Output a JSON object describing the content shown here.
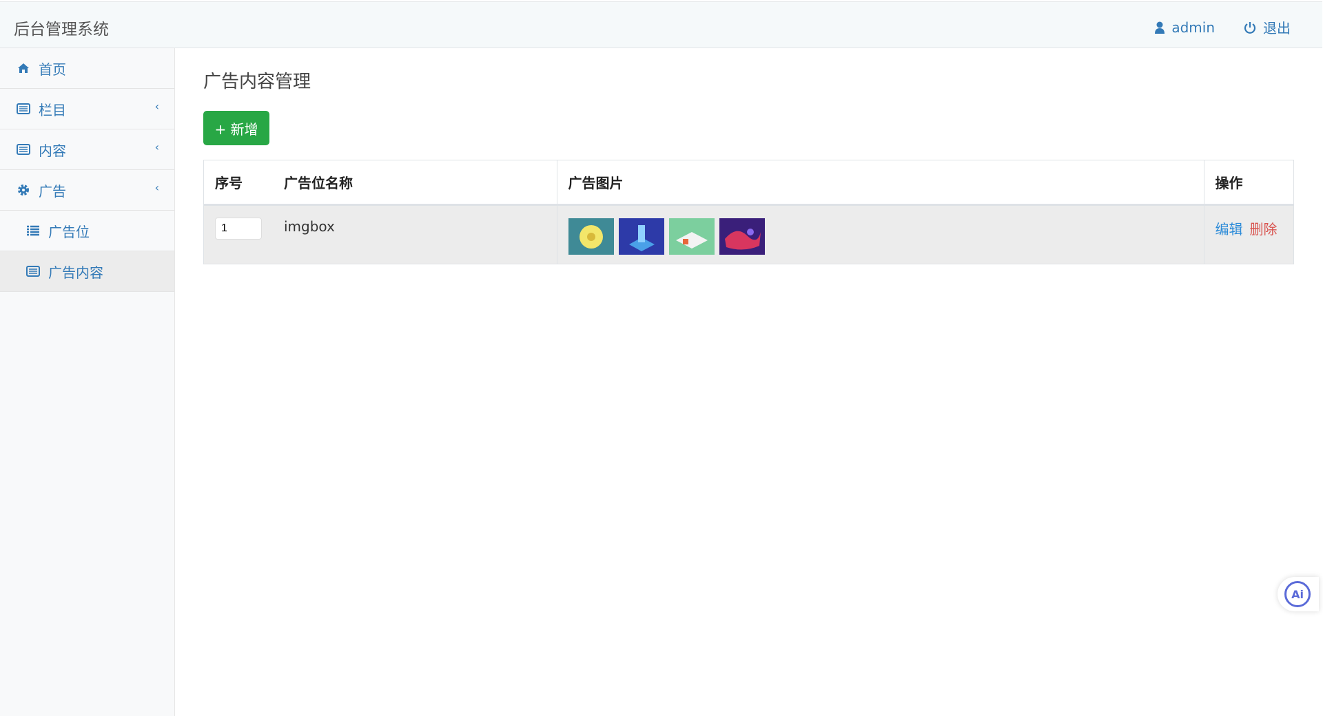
{
  "header": {
    "title": "后台管理系统",
    "user": "admin",
    "logout": "退出"
  },
  "sidebar": {
    "items": [
      {
        "label": "首页",
        "icon": "home-icon"
      },
      {
        "label": "栏目",
        "icon": "list-alt-icon"
      },
      {
        "label": "内容",
        "icon": "list-alt-icon"
      },
      {
        "label": "广告",
        "icon": "gear-icon"
      },
      {
        "label": "广告位",
        "icon": "list-icon"
      },
      {
        "label": "广告内容",
        "icon": "list-alt-icon"
      }
    ]
  },
  "main": {
    "title": "广告内容管理",
    "add_label": "+ 新增",
    "columns": [
      "序号",
      "广告位名称",
      "广告图片",
      "操作"
    ],
    "rows": [
      {
        "seq": "1",
        "name": "imgbox",
        "edit": "编辑",
        "delete": "删除"
      }
    ]
  },
  "ai": {
    "label": "Ai"
  },
  "colors": {
    "accent": "#337ab7",
    "success": "#28a745",
    "danger": "#d9534f"
  }
}
